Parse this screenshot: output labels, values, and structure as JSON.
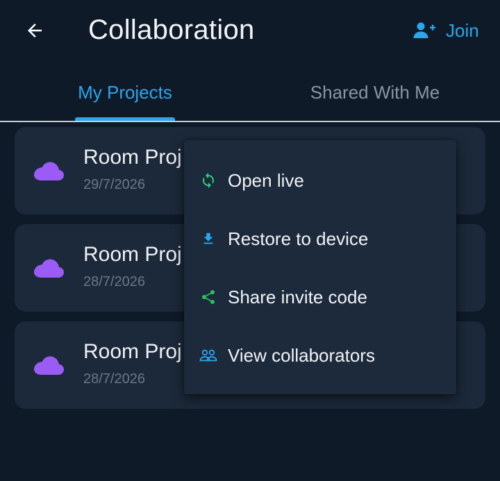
{
  "header": {
    "title": "Collaboration",
    "join_label": "Join"
  },
  "tabs": [
    {
      "label": "My Projects",
      "active": true
    },
    {
      "label": "Shared With Me",
      "active": false
    }
  ],
  "projects": [
    {
      "name": "Room Proj",
      "date": "29/7/2026"
    },
    {
      "name": "Room Proj",
      "date": "28/7/2026"
    },
    {
      "name": "Room Proj",
      "date": "28/7/2026"
    }
  ],
  "menu": {
    "items": [
      {
        "label": "Open live",
        "icon": "sync-icon",
        "color": "#2ecf7a"
      },
      {
        "label": "Restore to device",
        "icon": "download-icon",
        "color": "#2aa6ee"
      },
      {
        "label": "Share invite code",
        "icon": "share-icon",
        "color": "#27c25f"
      },
      {
        "label": "View collaborators",
        "icon": "group-icon",
        "color": "#2aa6ee"
      }
    ]
  },
  "colors": {
    "background": "#0f1a28",
    "card": "#1c293a",
    "accent": "#2aa6ee",
    "cloud": "#9b5cf6"
  }
}
